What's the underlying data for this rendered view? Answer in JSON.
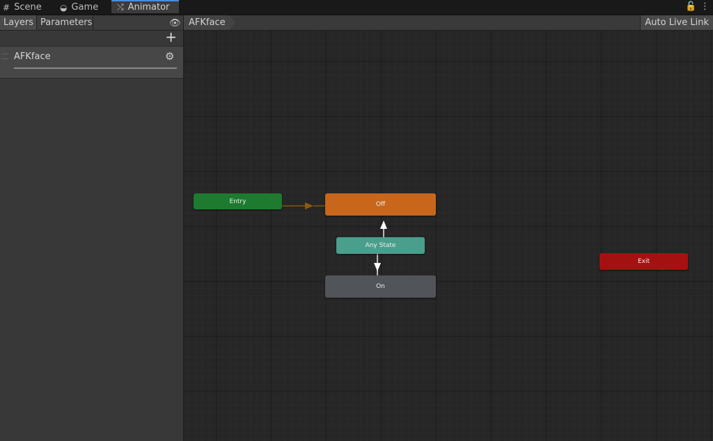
{
  "tabs": [
    {
      "icon": "grid-icon",
      "glyph": "#",
      "label": "Scene"
    },
    {
      "icon": "gamepad-icon",
      "glyph": "◒",
      "label": "Game"
    },
    {
      "icon": "animator-icon",
      "glyph": "⤭",
      "label": "Animator"
    }
  ],
  "window_controls": {
    "lock": "🔓",
    "menu": "⋮"
  },
  "left_panel": {
    "tab_layers": "Layers",
    "tab_parameters": "Parameters",
    "eye": "👁",
    "add": "+",
    "layers": [
      {
        "name": "AFKface",
        "gear": "⚙"
      }
    ]
  },
  "graph_toolbar": {
    "breadcrumb": "AFKface",
    "auto_live_link": "Auto Live Link"
  },
  "states": {
    "entry": "Entry",
    "off": "Off",
    "any_state": "Any State",
    "on": "On",
    "exit": "Exit"
  },
  "colors": {
    "entry": "#1e7a2e",
    "off": "#c8661b",
    "any_state": "#4a9e8c",
    "on": "#515458",
    "exit": "#a51111",
    "accent": "#4a8de0"
  }
}
